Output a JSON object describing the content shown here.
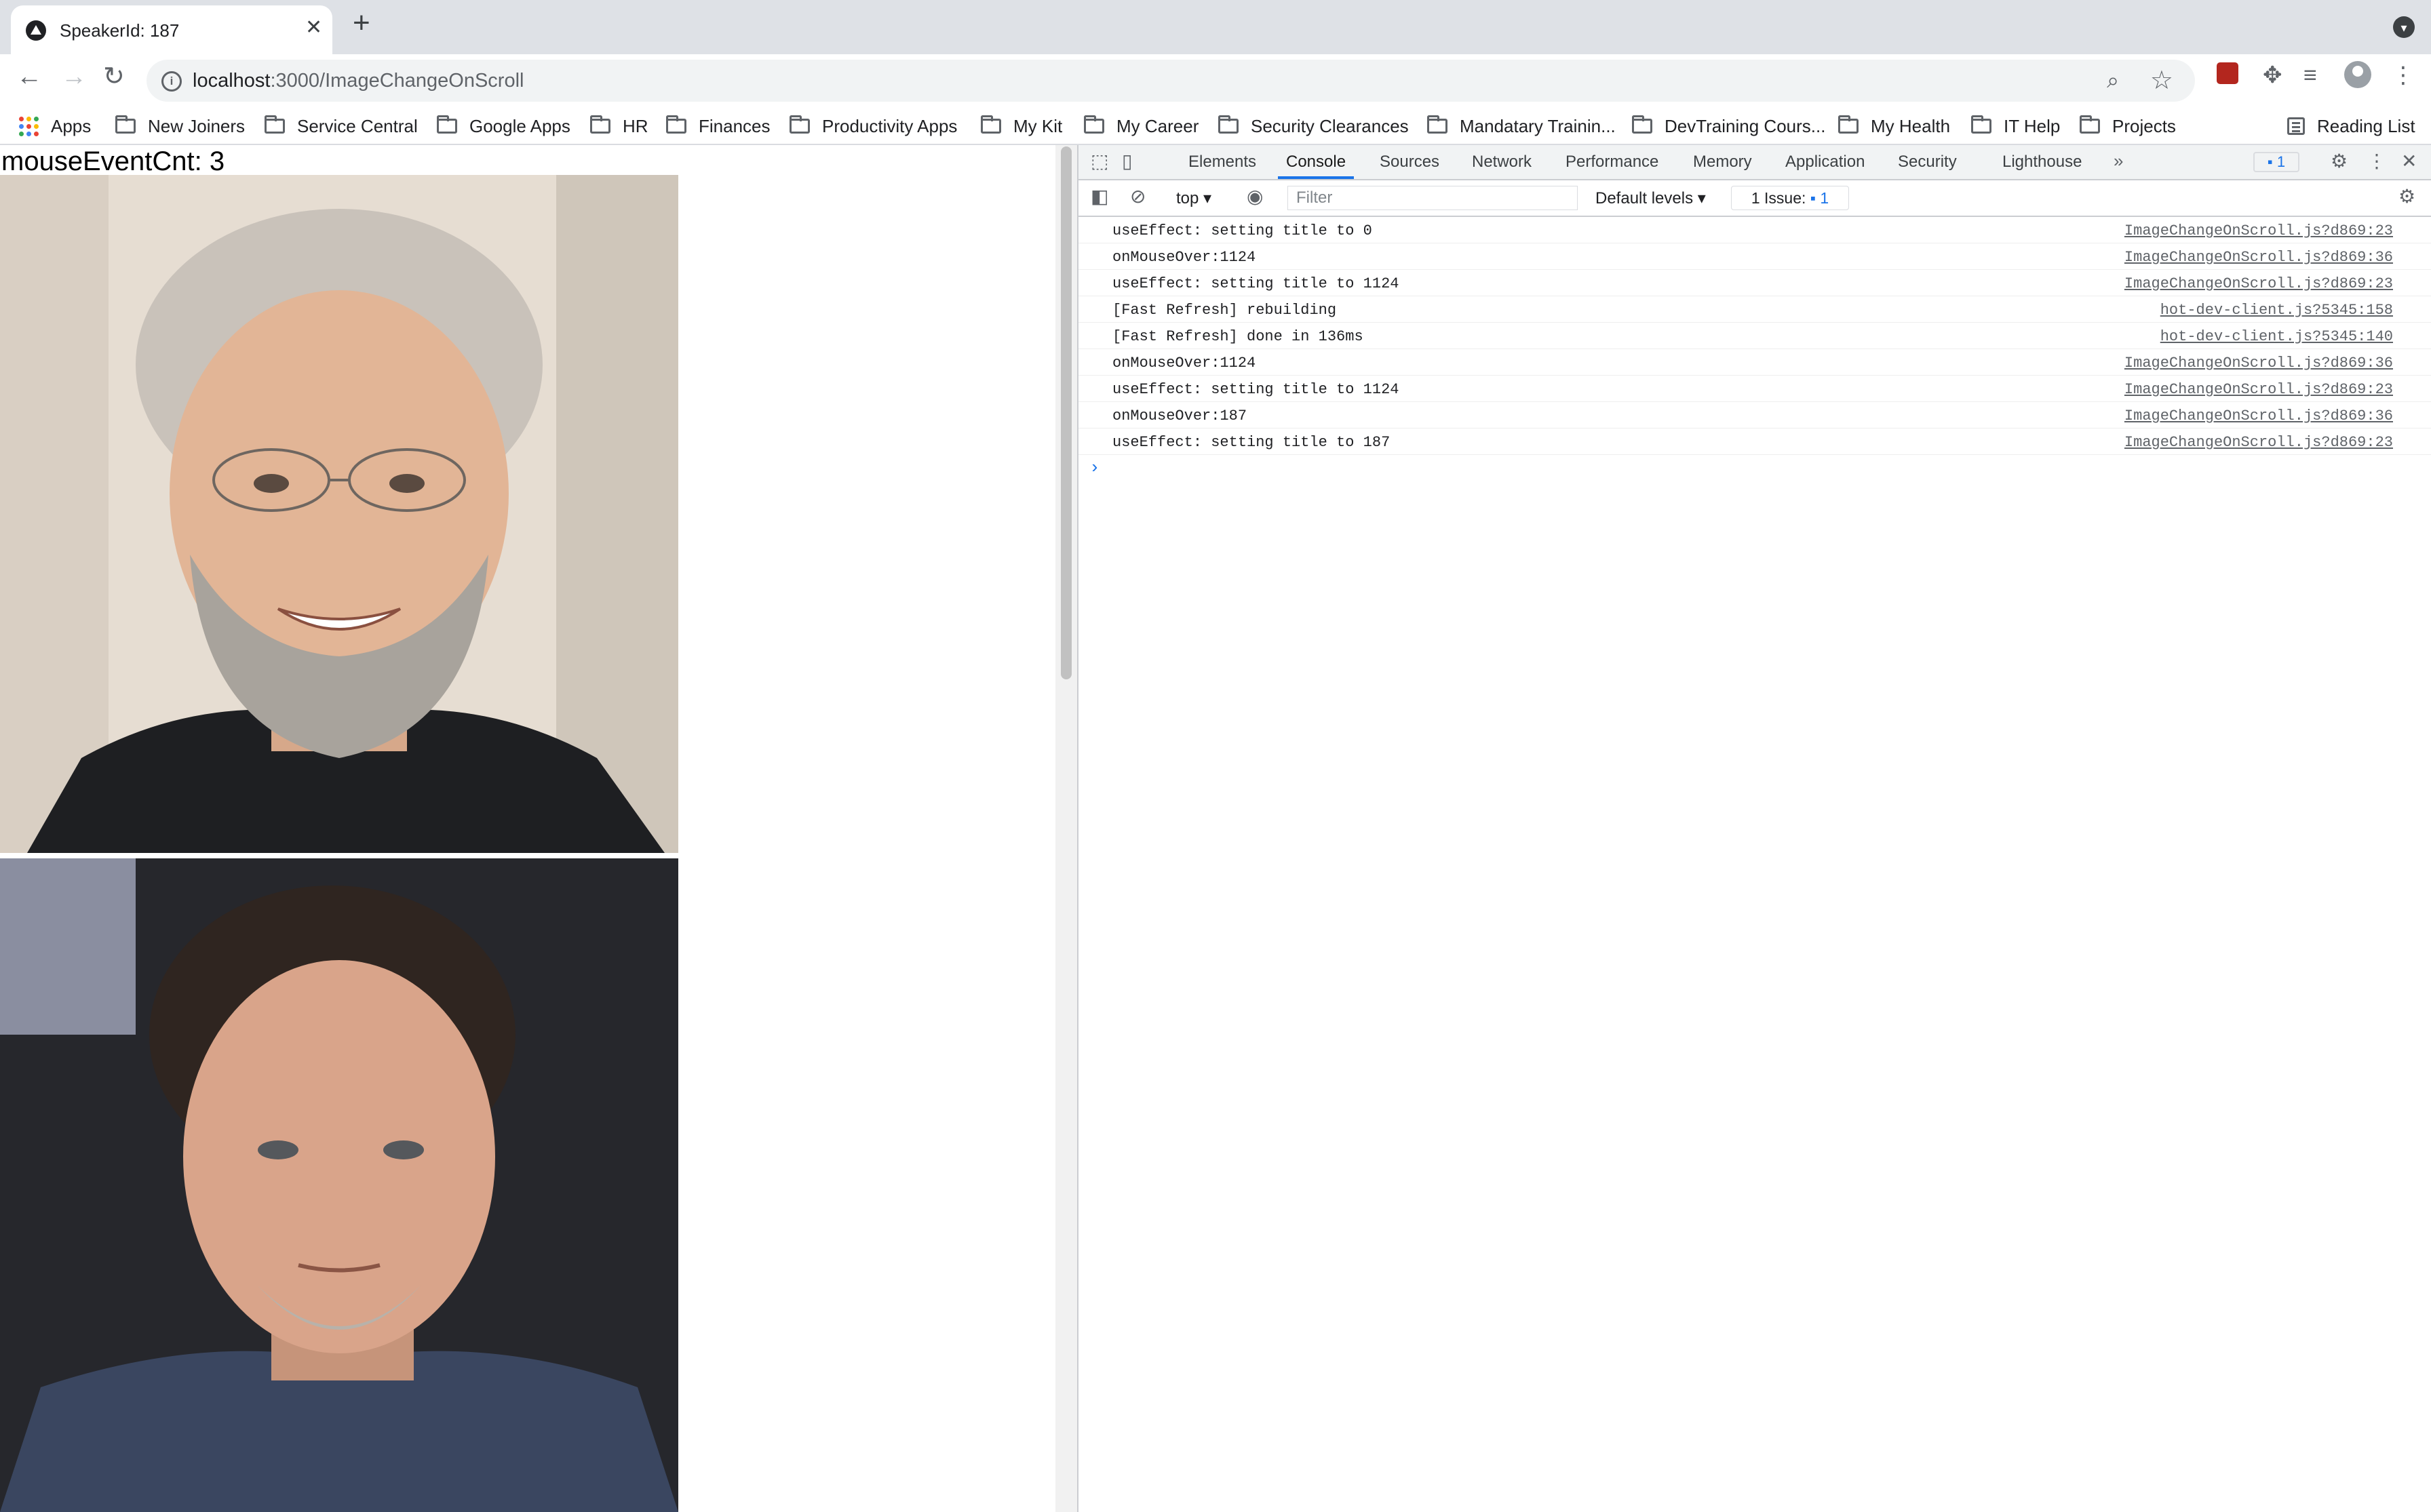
{
  "browser": {
    "tab_title": "SpeakerId: 187",
    "url_host": "localhost",
    "url_path": ":3000/ImageChangeOnScroll"
  },
  "bookmarks": {
    "apps_label": "Apps",
    "items": [
      "New Joiners",
      "Service Central",
      "Google Apps",
      "HR",
      "Finances",
      "Productivity Apps",
      "My Kit",
      "My Career",
      "Security Clearances",
      "Mandatary Trainin...",
      "DevTraining Cours...",
      "My Health",
      "IT Help",
      "Projects"
    ],
    "reading_list": "Reading List"
  },
  "page": {
    "counter_text": "mouseEventCnt: 3"
  },
  "devtools": {
    "tabs": [
      "Elements",
      "Console",
      "Sources",
      "Network",
      "Performance",
      "Memory",
      "Application",
      "Security",
      "Lighthouse"
    ],
    "active_tab": "Console",
    "issues_badge": "1",
    "context": "top",
    "filter_placeholder": "Filter",
    "levels": "Default levels",
    "issue_chip_label": "1 Issue:",
    "issue_chip_count": "1",
    "logs": [
      {
        "msg": "useEffect: setting title to 0",
        "src": "ImageChangeOnScroll.js?d869:23"
      },
      {
        "msg": "onMouseOver:1124",
        "src": "ImageChangeOnScroll.js?d869:36"
      },
      {
        "msg": "useEffect: setting title to 1124",
        "src": "ImageChangeOnScroll.js?d869:23"
      },
      {
        "msg": "[Fast Refresh] rebuilding",
        "src": "hot-dev-client.js?5345:158"
      },
      {
        "msg": "[Fast Refresh] done in 136ms",
        "src": "hot-dev-client.js?5345:140"
      },
      {
        "msg": "onMouseOver:1124",
        "src": "ImageChangeOnScroll.js?d869:36"
      },
      {
        "msg": "useEffect: setting title to 1124",
        "src": "ImageChangeOnScroll.js?d869:23"
      },
      {
        "msg": "onMouseOver:187",
        "src": "ImageChangeOnScroll.js?d869:36"
      },
      {
        "msg": "useEffect: setting title to 187",
        "src": "ImageChangeOnScroll.js?d869:23"
      }
    ]
  }
}
